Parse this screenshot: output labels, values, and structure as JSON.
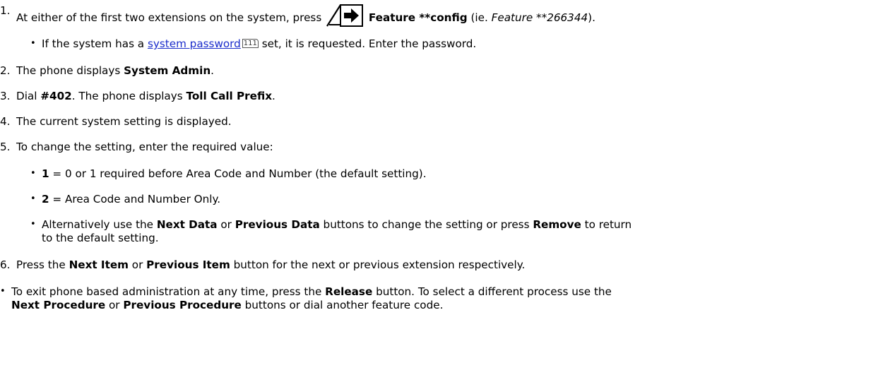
{
  "step1": {
    "num": "1.",
    "pre": "At either of the first two extensions on the system, press",
    "bold": "Feature **config",
    "mid": " (ie. ",
    "italic": "Feature **266344",
    "post": ")."
  },
  "step1_sub": {
    "pre": "If the system has a ",
    "link": "system password",
    "ref": "111",
    "post": " set, it is requested. Enter the password."
  },
  "step2": {
    "num": "2.",
    "pre": "The phone displays ",
    "bold": "System Admin",
    "post": "."
  },
  "step3": {
    "num": "3.",
    "pre": "Dial ",
    "bold1": "#402",
    "mid": ". The phone displays ",
    "bold2": "Toll Call Prefix",
    "post": "."
  },
  "step4": {
    "num": "4.",
    "text": "The current system setting is displayed."
  },
  "step5": {
    "num": "5.",
    "text": "To change the setting, enter the required value:"
  },
  "step5_opts": {
    "o1_bold": "1",
    "o1_text": " = 0 or 1 required before Area Code and Number (the default setting).",
    "o2_bold": "2",
    "o2_text": " = Area Code and Number Only.",
    "o3_pre": "Alternatively use the ",
    "o3_b1": "Next Data",
    "o3_m1": " or ",
    "o3_b2": "Previous Data",
    "o3_m2": " buttons to change the setting or press ",
    "o3_b3": "Remove",
    "o3_post": " to return",
    "o3_line2": "to the default setting."
  },
  "step6": {
    "num": "6.",
    "pre": "Press the ",
    "b1": "Next Item",
    "m1": " or ",
    "b2": "Previous Item",
    "post": " button for the next or previous extension respectively."
  },
  "exit": {
    "pre": "To exit phone based administration at any time, press the ",
    "b1": "Release",
    "m1": " button. To select a different process use the",
    "b2": "Next Procedure",
    "m2": " or ",
    "b3": "Previous Procedure",
    "post": " buttons or dial another feature code."
  },
  "bullet_char": "•"
}
